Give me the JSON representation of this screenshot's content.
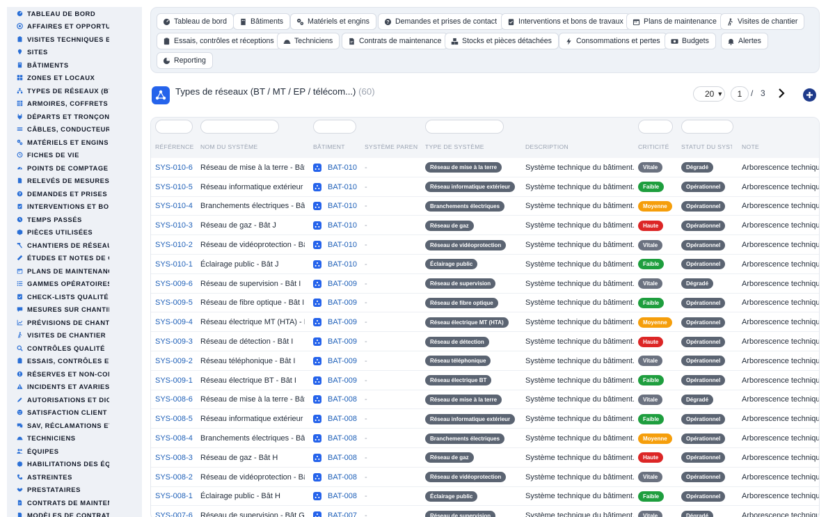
{
  "colors": {
    "accent": "#2563eb",
    "link": "#1d5fb8",
    "vitale": "#6b7280",
    "faible": "#1e9e3e",
    "moyenne": "#f59e0b",
    "haute": "#dc2626",
    "status": "#5b6472"
  },
  "sidebar": {
    "items": [
      {
        "label": "TABLEAU DE BORD",
        "icon": "dashboard-icon"
      },
      {
        "label": "AFFAIRES ET OPPORTUNITÉS",
        "icon": "target-icon"
      },
      {
        "label": "VISITES TECHNIQUES ET",
        "icon": "clipboard-icon"
      },
      {
        "label": "SITES",
        "icon": "map-pin-icon"
      },
      {
        "label": "BÂTIMENTS",
        "icon": "building-icon"
      },
      {
        "label": "ZONES ET LOCAUX",
        "icon": "grid-icon"
      },
      {
        "label": "TYPES DE RÉSEAUX (BT / MT / EP / TÉLÉCOM...)",
        "icon": "network-icon"
      },
      {
        "label": "ARMOIRES, COFFRETS ET",
        "icon": "cabinet-icon"
      },
      {
        "label": "DÉPARTS ET TRONÇONS",
        "icon": "plug-icon"
      },
      {
        "label": "CÂBLES, CONDUCTEURS",
        "icon": "cable-icon"
      },
      {
        "label": "MATÉRIELS ET ENGINS",
        "icon": "gears-icon"
      },
      {
        "label": "FICHES DE VIE",
        "icon": "history-icon"
      },
      {
        "label": "POINTS DE COMPTAGE ET",
        "icon": "gauge-icon"
      },
      {
        "label": "RELEVÉS DE MESURES",
        "icon": "file-icon"
      },
      {
        "label": "DEMANDES ET PRISES DE CONTACT",
        "icon": "question-icon"
      },
      {
        "label": "INTERVENTIONS ET BONS DE TRAVAUX",
        "icon": "clipboard-check-icon"
      },
      {
        "label": "TEMPS PASSÉS",
        "icon": "clock-icon"
      },
      {
        "label": "PIÈCES UTILISÉES",
        "icon": "box-icon"
      },
      {
        "label": "CHANTIERS DE RÉSEAUX",
        "icon": "hammer-icon"
      },
      {
        "label": "ÉTUDES ET NOTES DE CALCUL",
        "icon": "ruler-icon"
      },
      {
        "label": "PLANS DE MAINTENANCE",
        "icon": "calendar-icon"
      },
      {
        "label": "GAMMES OPÉRATOIRES",
        "icon": "list-icon"
      },
      {
        "label": "CHECK-LISTS QUALITÉ",
        "icon": "checklist-icon"
      },
      {
        "label": "MESURES SUR CHANTIER",
        "icon": "comment-icon"
      },
      {
        "label": "PRÉVISIONS DE CHANTIER",
        "icon": "chart-icon"
      },
      {
        "label": "VISITES DE CHANTIER",
        "icon": "walk-icon"
      },
      {
        "label": "CONTRÔLES QUALITÉ",
        "icon": "search-icon"
      },
      {
        "label": "ESSAIS, CONTRÔLES ET",
        "icon": "clipboard-icon"
      },
      {
        "label": "RÉSERVES ET NON-CONFORMITÉS",
        "icon": "alert-icon"
      },
      {
        "label": "INCIDENTS ET AVARIES",
        "icon": "warning-icon"
      },
      {
        "label": "AUTORISATIONS ET DICT",
        "icon": "pen-icon"
      },
      {
        "label": "SATISFACTION CLIENT",
        "icon": "smile-icon"
      },
      {
        "label": "SAV, RÉCLAMATIONS ET",
        "icon": "chat-icon"
      },
      {
        "label": "TECHNICIENS",
        "icon": "helmet-icon"
      },
      {
        "label": "ÉQUIPES",
        "icon": "users-icon"
      },
      {
        "label": "HABILITATIONS DES ÉQUIPES",
        "icon": "badge-icon"
      },
      {
        "label": "ASTREINTES",
        "icon": "phone-icon"
      },
      {
        "label": "PRESTATAIRES",
        "icon": "handshake-icon"
      },
      {
        "label": "CONTRATS DE MAINTENANCE",
        "icon": "contract-icon"
      },
      {
        "label": "MODÈLES DE CONTRATS",
        "icon": "file-icon"
      }
    ]
  },
  "nav": {
    "tabs": [
      {
        "label": "Tableau de bord",
        "icon": "dashboard-icon"
      },
      {
        "label": "Bâtiments",
        "icon": "building-icon"
      },
      {
        "label": "Matériels et engins",
        "icon": "gears-icon"
      },
      {
        "label": "Demandes et prises de contact",
        "icon": "question-icon"
      },
      {
        "label": "Interventions et bons de travaux",
        "icon": "clipboard-check-icon"
      },
      {
        "label": "Plans de maintenance",
        "icon": "calendar-icon"
      },
      {
        "label": "Visites de chantier",
        "icon": "walk-icon"
      },
      {
        "label": "Essais, contrôles et réceptions",
        "icon": "clipboard-icon"
      },
      {
        "label": "Techniciens",
        "icon": "helmet-icon"
      },
      {
        "label": "Contrats de maintenance",
        "icon": "contract-icon"
      },
      {
        "label": "Stocks et pièces détachées",
        "icon": "boxes-icon"
      },
      {
        "label": "Consommations et pertes",
        "icon": "bolt-icon"
      },
      {
        "label": "Budgets",
        "icon": "money-icon"
      },
      {
        "label": "Alertes",
        "icon": "bell-icon"
      },
      {
        "label": "Reporting",
        "icon": "pie-icon"
      }
    ]
  },
  "header": {
    "title": "Types de réseaux (BT / MT / EP / télécom...)",
    "count": "(60)",
    "page_size": "20",
    "page": "1",
    "slash": "/",
    "total_pages": "3"
  },
  "table": {
    "columns": {
      "ref": "RÉFÉRENCE",
      "name": "NOM DU SYSTÈME",
      "bat": "BÂTIMENT",
      "parent": "SYSTÈME PARENT",
      "type": "TYPE DE SYSTÈME",
      "desc": "DESCRIPTION",
      "crit": "CRITICITÉ",
      "stat": "STATUT DU SYSTÈME",
      "note": "NOTE"
    },
    "rows": [
      {
        "ref": "SYS-010-6",
        "name": "Réseau de mise à la terre - Bât J",
        "bat": "BAT-010",
        "parent": "-",
        "type": "Réseau de mise à la terre",
        "desc": "Système technique du bâtiment.",
        "crit": "Vitale",
        "stat": "Dégradé",
        "note": "Arborescence technique"
      },
      {
        "ref": "SYS-010-5",
        "name": "Réseau informatique extérieur - Bât J",
        "bat": "BAT-010",
        "parent": "-",
        "type": "Réseau informatique extérieur",
        "desc": "Système technique du bâtiment.",
        "crit": "Faible",
        "stat": "Opérationnel",
        "note": "Arborescence technique"
      },
      {
        "ref": "SYS-010-4",
        "name": "Branchements électriques - Bât J",
        "bat": "BAT-010",
        "parent": "-",
        "type": "Branchements électriques",
        "desc": "Système technique du bâtiment.",
        "crit": "Moyenne",
        "stat": "Opérationnel",
        "note": "Arborescence technique"
      },
      {
        "ref": "SYS-010-3",
        "name": "Réseau de gaz - Bât J",
        "bat": "BAT-010",
        "parent": "-",
        "type": "Réseau de gaz",
        "desc": "Système technique du bâtiment.",
        "crit": "Haute",
        "stat": "Opérationnel",
        "note": "Arborescence technique"
      },
      {
        "ref": "SYS-010-2",
        "name": "Réseau de vidéoprotection - Bât J",
        "bat": "BAT-010",
        "parent": "-",
        "type": "Réseau de vidéoprotection",
        "desc": "Système technique du bâtiment.",
        "crit": "Vitale",
        "stat": "Opérationnel",
        "note": "Arborescence technique"
      },
      {
        "ref": "SYS-010-1",
        "name": "Éclairage public - Bât J",
        "bat": "BAT-010",
        "parent": "-",
        "type": "Éclairage public",
        "desc": "Système technique du bâtiment.",
        "crit": "Faible",
        "stat": "Opérationnel",
        "note": "Arborescence technique"
      },
      {
        "ref": "SYS-009-6",
        "name": "Réseau de supervision - Bât I",
        "bat": "BAT-009",
        "parent": "-",
        "type": "Réseau de supervision",
        "desc": "Système technique du bâtiment.",
        "crit": "Vitale",
        "stat": "Dégradé",
        "note": "Arborescence technique"
      },
      {
        "ref": "SYS-009-5",
        "name": "Réseau de fibre optique - Bât I",
        "bat": "BAT-009",
        "parent": "-",
        "type": "Réseau de fibre optique",
        "desc": "Système technique du bâtiment.",
        "crit": "Faible",
        "stat": "Opérationnel",
        "note": "Arborescence technique"
      },
      {
        "ref": "SYS-009-4",
        "name": "Réseau électrique MT (HTA) - Bât I",
        "bat": "BAT-009",
        "parent": "-",
        "type": "Réseau électrique MT (HTA)",
        "desc": "Système technique du bâtiment.",
        "crit": "Moyenne",
        "stat": "Opérationnel",
        "note": "Arborescence technique"
      },
      {
        "ref": "SYS-009-3",
        "name": "Réseau de détection - Bât I",
        "bat": "BAT-009",
        "parent": "-",
        "type": "Réseau de détection",
        "desc": "Système technique du bâtiment.",
        "crit": "Haute",
        "stat": "Opérationnel",
        "note": "Arborescence technique"
      },
      {
        "ref": "SYS-009-2",
        "name": "Réseau téléphonique - Bât I",
        "bat": "BAT-009",
        "parent": "-",
        "type": "Réseau téléphonique",
        "desc": "Système technique du bâtiment.",
        "crit": "Vitale",
        "stat": "Opérationnel",
        "note": "Arborescence technique"
      },
      {
        "ref": "SYS-009-1",
        "name": "Réseau électrique BT - Bât I",
        "bat": "BAT-009",
        "parent": "-",
        "type": "Réseau électrique BT",
        "desc": "Système technique du bâtiment.",
        "crit": "Faible",
        "stat": "Opérationnel",
        "note": "Arborescence technique"
      },
      {
        "ref": "SYS-008-6",
        "name": "Réseau de mise à la terre - Bât H",
        "bat": "BAT-008",
        "parent": "-",
        "type": "Réseau de mise à la terre",
        "desc": "Système technique du bâtiment.",
        "crit": "Vitale",
        "stat": "Dégradé",
        "note": "Arborescence technique"
      },
      {
        "ref": "SYS-008-5",
        "name": "Réseau informatique extérieur - Bât H",
        "bat": "BAT-008",
        "parent": "-",
        "type": "Réseau informatique extérieur",
        "desc": "Système technique du bâtiment.",
        "crit": "Faible",
        "stat": "Opérationnel",
        "note": "Arborescence technique"
      },
      {
        "ref": "SYS-008-4",
        "name": "Branchements électriques - Bât H",
        "bat": "BAT-008",
        "parent": "-",
        "type": "Branchements électriques",
        "desc": "Système technique du bâtiment.",
        "crit": "Moyenne",
        "stat": "Opérationnel",
        "note": "Arborescence technique"
      },
      {
        "ref": "SYS-008-3",
        "name": "Réseau de gaz - Bât H",
        "bat": "BAT-008",
        "parent": "-",
        "type": "Réseau de gaz",
        "desc": "Système technique du bâtiment.",
        "crit": "Haute",
        "stat": "Opérationnel",
        "note": "Arborescence technique"
      },
      {
        "ref": "SYS-008-2",
        "name": "Réseau de vidéoprotection - Bât H",
        "bat": "BAT-008",
        "parent": "-",
        "type": "Réseau de vidéoprotection",
        "desc": "Système technique du bâtiment.",
        "crit": "Vitale",
        "stat": "Opérationnel",
        "note": "Arborescence technique"
      },
      {
        "ref": "SYS-008-1",
        "name": "Éclairage public - Bât H",
        "bat": "BAT-008",
        "parent": "-",
        "type": "Éclairage public",
        "desc": "Système technique du bâtiment.",
        "crit": "Faible",
        "stat": "Opérationnel",
        "note": "Arborescence technique"
      },
      {
        "ref": "SYS-007-6",
        "name": "Réseau de supervision - Bât G",
        "bat": "BAT-007",
        "parent": "-",
        "type": "Réseau de supervision",
        "desc": "Système technique du bâtiment.",
        "crit": "Vitale",
        "stat": "Dégradé",
        "note": "Arborescence technique"
      }
    ]
  }
}
